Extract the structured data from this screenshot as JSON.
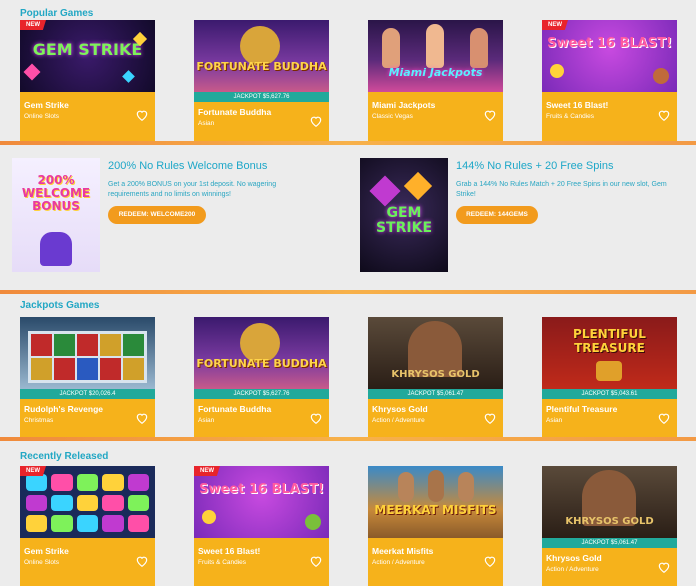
{
  "sections": {
    "popular": {
      "title": "Popular Games",
      "cards": [
        {
          "name": "Gem Strike",
          "category": "Online Slots",
          "badge": "NEW",
          "art": "GEM STRIKE"
        },
        {
          "name": "Fortunate Buddha",
          "category": "Asian",
          "jackpot": "JACKPOT $5,627.76",
          "art": "FORTUNATE BUDDHA"
        },
        {
          "name": "Miami Jackpots",
          "category": "Classic Vegas",
          "art": "Miami Jackpots"
        },
        {
          "name": "Sweet 16 Blast!",
          "category": "Fruits & Candies",
          "badge": "NEW",
          "art": "Sweet 16 BLAST!"
        }
      ]
    },
    "promos": [
      {
        "title": "200% No Rules Welcome Bonus",
        "description": "Get a 200% BONUS on your 1st deposit. No wagering requirements and no limits on winnings!",
        "button": "REDEEM: WELCOME200",
        "art": "200% WELCOME BONUS"
      },
      {
        "title": "144% No Rules + 20 Free Spins",
        "description": "Grab a 144% No Rules Match + 20 Free Spins in our new slot, Gem Strike!",
        "button": "REDEEM: 144GEMS",
        "art": "GEM STRIKE"
      }
    ],
    "jackpots": {
      "title": "Jackpots Games",
      "cards": [
        {
          "name": "Rudolph's Revenge",
          "category": "Christmas",
          "jackpot": "JACKPOT $20,026.4"
        },
        {
          "name": "Fortunate Buddha",
          "category": "Asian",
          "jackpot": "JACKPOT $5,627.76",
          "art": "FORTUNATE BUDDHA"
        },
        {
          "name": "Khrysos Gold",
          "category": "Action / Adventure",
          "jackpot": "JACKPOT $5,061.47",
          "art": "KHRYSOS GOLD"
        },
        {
          "name": "Plentiful Treasure",
          "category": "Asian",
          "jackpot": "JACKPOT $5,043.61",
          "art": "PLENTIFUL TREASURE"
        }
      ]
    },
    "recent": {
      "title": "Recently Released",
      "cards": [
        {
          "name": "Gem Strike",
          "category": "Online Slots",
          "badge": "NEW"
        },
        {
          "name": "Sweet 16 Blast!",
          "category": "Fruits & Candies",
          "badge": "NEW",
          "art": "Sweet 16 BLAST!"
        },
        {
          "name": "Meerkat Misfits",
          "category": "Action / Adventure",
          "art": "MEERKAT MISFITS"
        },
        {
          "name": "Khrysos Gold",
          "category": "Action / Adventure",
          "jackpot": "JACKPOT $5,061.47",
          "art": "KHRYSOS GOLD"
        }
      ]
    }
  },
  "colors": {
    "accent": "#22a7c4",
    "card_info": "#f6b21b",
    "jackpot_bar": "#21a99b",
    "badge": "#e8242b",
    "button": "#f29b1d"
  }
}
